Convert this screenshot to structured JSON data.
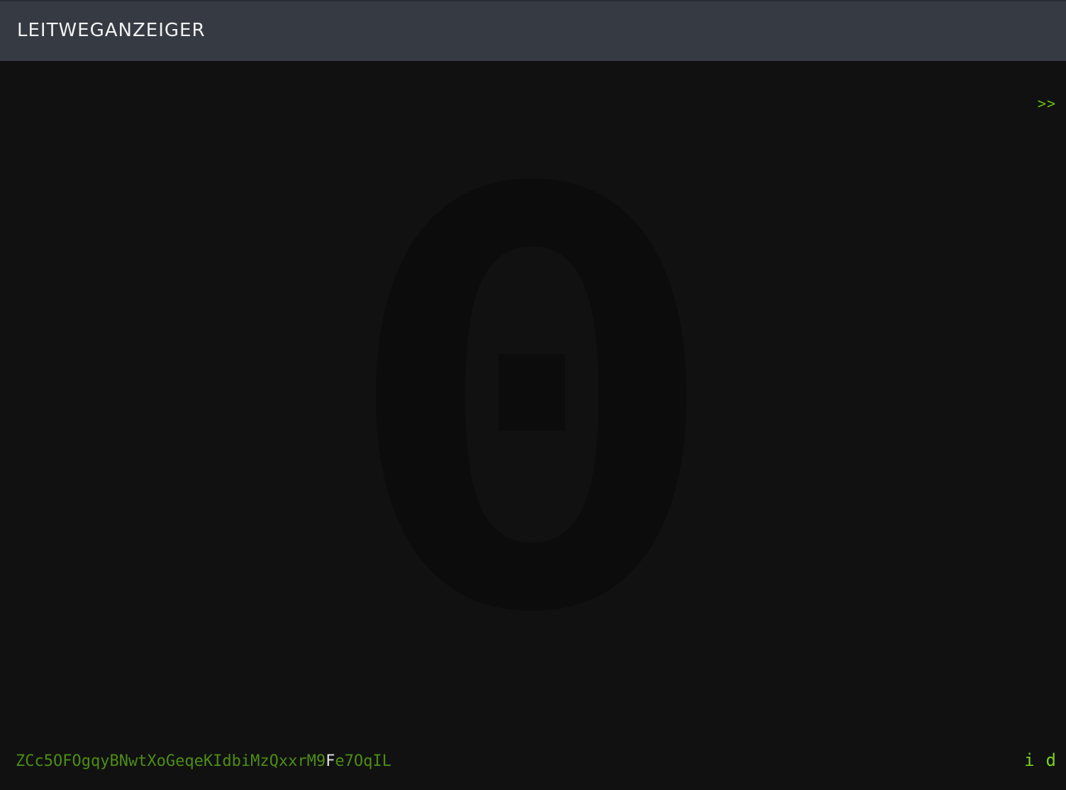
{
  "header": {
    "title": "LEITWEGANZEIGER"
  },
  "main": {
    "next_label": ">>",
    "display_char": "0"
  },
  "footer": {
    "code_before": "ZCc5OFOgqyBNwtXoGeqeKIdbiMzQxxrM9",
    "code_highlight": "F",
    "code_after": "e7OqIL",
    "action_i": "i",
    "action_d": "d"
  },
  "colors": {
    "header_bg": "#363a43",
    "background": "#111111",
    "accent_green": "#6abf1a",
    "code_green": "#4c8d16",
    "highlight": "#e6e6e6",
    "glyph": "#0c0c0c"
  },
  "icons": {
    "next": "double-chevron-right-icon"
  }
}
